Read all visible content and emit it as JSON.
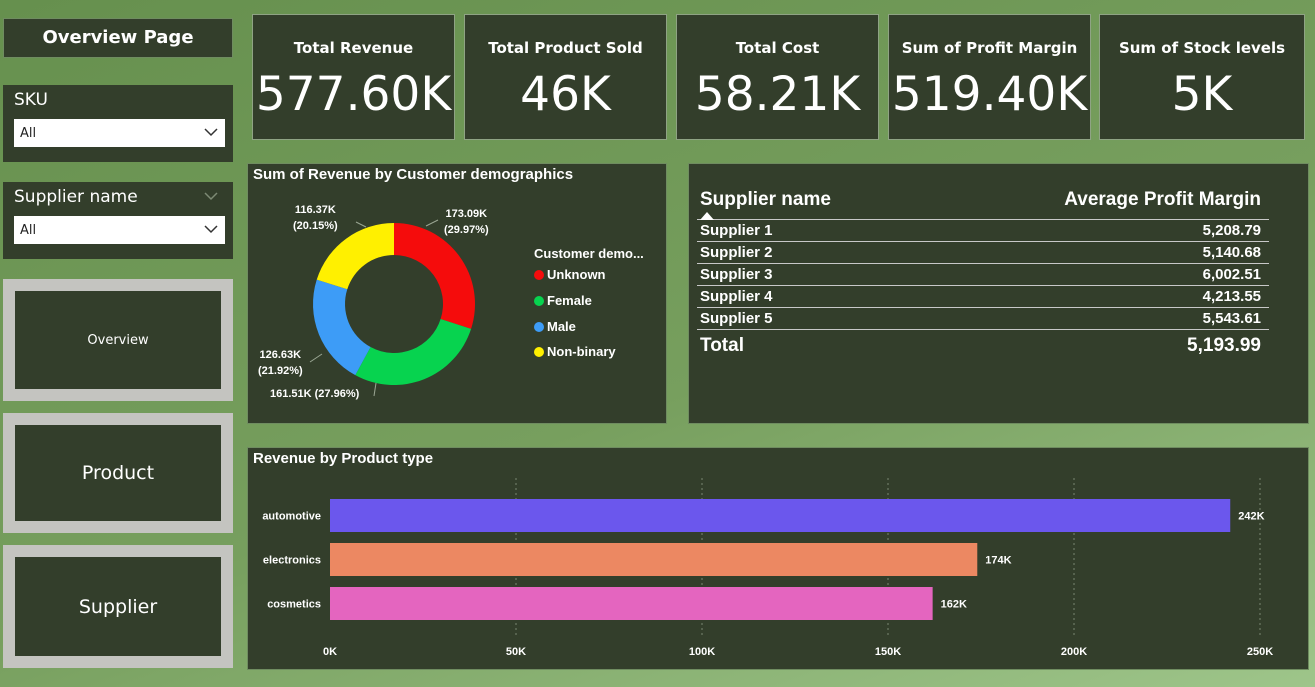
{
  "page_title": "Overview Page",
  "slicers": [
    {
      "label": "SKU",
      "value": "All"
    },
    {
      "label": "Supplier name",
      "value": "All"
    }
  ],
  "nav": {
    "overview": "Overview",
    "product": "Product",
    "supplier": "Supplier"
  },
  "kpis": [
    {
      "title": "Total Revenue",
      "value": "577.60K"
    },
    {
      "title": "Total Product Sold",
      "value": "46K"
    },
    {
      "title": "Total Cost",
      "value": "58.21K"
    },
    {
      "title": "Sum of Profit Margin",
      "value": "519.40K"
    },
    {
      "title": "Sum of Stock levels",
      "value": "5K"
    }
  ],
  "supplier_table": {
    "headers": [
      "Supplier name",
      "Average Profit Margin"
    ],
    "rows": [
      {
        "name": "Supplier 1",
        "value": "5,208.79"
      },
      {
        "name": "Supplier 2",
        "value": "5,140.68"
      },
      {
        "name": "Supplier 3",
        "value": "6,002.51"
      },
      {
        "name": "Supplier 4",
        "value": "4,213.55"
      },
      {
        "name": "Supplier 5",
        "value": "5,543.61"
      }
    ],
    "total_label": "Total",
    "total_value": "5,193.99"
  },
  "chart_data": [
    {
      "type": "pie",
      "title": "Sum of Revenue by Customer demographics",
      "legend_title": "Customer demo...",
      "legend_position": "right",
      "slices": [
        {
          "name": "Unknown",
          "value": 173.09,
          "label": "173.09K",
          "pct": "(29.97%)",
          "color": "#f50c0c"
        },
        {
          "name": "Female",
          "value": 161.51,
          "label": "161.51K (27.96%)",
          "color": "#07d34f"
        },
        {
          "name": "Male",
          "value": 126.63,
          "label": "126.63K",
          "pct": "(21.92%)",
          "color": "#3d9cf7"
        },
        {
          "name": "Non-binary",
          "value": 116.37,
          "label": "116.37K",
          "pct": "(20.15%)",
          "color": "#fff000"
        }
      ]
    },
    {
      "type": "bar",
      "orientation": "horizontal",
      "title": "Revenue by Product type",
      "categories": [
        "automotive",
        "electronics",
        "cosmetics"
      ],
      "values": [
        242,
        174,
        162
      ],
      "value_labels": [
        "242K",
        "174K",
        "162K"
      ],
      "colors": [
        "#6b57ed",
        "#ec8862",
        "#e465bf"
      ],
      "xlim": [
        0,
        250
      ],
      "xticks": [
        "0K",
        "50K",
        "100K",
        "150K",
        "200K",
        "250K"
      ],
      "grid": true
    }
  ]
}
